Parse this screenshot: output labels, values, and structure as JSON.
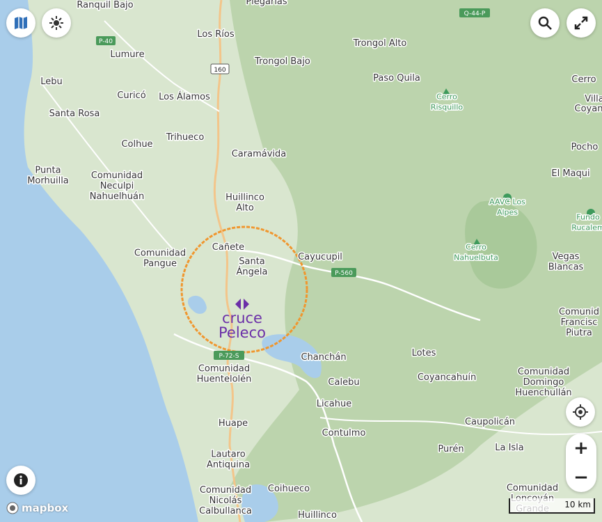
{
  "map": {
    "places": [
      {
        "id": "ranquil-bajo",
        "label": "Ranquil Bajo"
      },
      {
        "id": "pleglarias",
        "label": "Plegarias"
      },
      {
        "id": "los-rios",
        "label": "Los Ríos"
      },
      {
        "id": "trongol-alto",
        "label": "Trongol Alto"
      },
      {
        "id": "lumure",
        "label": "Lumure"
      },
      {
        "id": "trongol-bajo",
        "label": "Trongol Bajo"
      },
      {
        "id": "lebu",
        "label": "Lebu"
      },
      {
        "id": "paso-quila",
        "label": "Paso Quila"
      },
      {
        "id": "cerro",
        "label": "Cerro"
      },
      {
        "id": "curico",
        "label": "Curicó"
      },
      {
        "id": "los-alamos",
        "label": "Los Álamos"
      },
      {
        "id": "villa",
        "label": "Villa"
      },
      {
        "id": "santa-rosa",
        "label": "Santa Rosa"
      },
      {
        "id": "coyanco",
        "label": "Coyan"
      },
      {
        "id": "trihueco",
        "label": "Trihueco"
      },
      {
        "id": "colhue",
        "label": "Colhue"
      },
      {
        "id": "pocho",
        "label": "Pocho"
      },
      {
        "id": "caramavida",
        "label": "Caramávida"
      },
      {
        "id": "el-maqui",
        "label": "El Maqui"
      },
      {
        "id": "punta-morhuilla",
        "label": "Punta\nMorhuilla"
      },
      {
        "id": "comunidad-neculpi",
        "label": "Comunidad\nNeculpi\nNahuelhuán"
      },
      {
        "id": "huillinco-alto",
        "label": "Huillinco\nAlto"
      },
      {
        "id": "canete",
        "label": "Cañete"
      },
      {
        "id": "comunidad-pangue",
        "label": "Comunidad\nPangue"
      },
      {
        "id": "santa-angela",
        "label": "Santa\nÁngela"
      },
      {
        "id": "cayucupil",
        "label": "Cayucupil"
      },
      {
        "id": "vegas-blancas",
        "label": "Vegas\nBlancas"
      },
      {
        "id": "chanchan",
        "label": "Chanchán"
      },
      {
        "id": "lotes",
        "label": "Lotes"
      },
      {
        "id": "comunidad-francisco",
        "label": "Comunid\nFrancisc\nPiutra"
      },
      {
        "id": "comunidad-huentelolen",
        "label": "Comunidad\nHuentelolén"
      },
      {
        "id": "calebu",
        "label": "Calebu"
      },
      {
        "id": "coyancahuin",
        "label": "Coyancahuín"
      },
      {
        "id": "comunidad-domingo",
        "label": "Comunidad\nDomingo\nHuenchullán"
      },
      {
        "id": "licahue",
        "label": "Licahue"
      },
      {
        "id": "huape",
        "label": "Huape"
      },
      {
        "id": "caupolican",
        "label": "Caupolicán"
      },
      {
        "id": "contulmo",
        "label": "Contulmo"
      },
      {
        "id": "puren",
        "label": "Purén"
      },
      {
        "id": "la-isla",
        "label": "La Isla"
      },
      {
        "id": "lautaro-antiquina",
        "label": "Lautaro\nAntiquina"
      },
      {
        "id": "coihueco",
        "label": "Coihueco"
      },
      {
        "id": "comunidad-nicolas",
        "label": "Comunidad\nNicolás\nCalbullanca"
      },
      {
        "id": "huillinco",
        "label": "Huillinco"
      },
      {
        "id": "comunidad-oncoyan",
        "label": "Comunidad\nLoncoyán\nGrande"
      }
    ],
    "peaks": [
      {
        "id": "cerro-risquillo",
        "label": "Cerro\nRisquillo"
      },
      {
        "id": "aavc-los-alpes",
        "label": "AAVC Los\nAlpes"
      },
      {
        "id": "cerro-nahuelbuta",
        "label": "Cerro\nNahuelbuta"
      },
      {
        "id": "fundo-rucalem",
        "label": "Fundo\nRucalem"
      }
    ],
    "road_shields": [
      {
        "id": "p-40",
        "label": "P-40"
      },
      {
        "id": "q-44-p",
        "label": "Q-44-P"
      },
      {
        "id": "r160",
        "label": "160"
      },
      {
        "id": "p-560",
        "label": "P-560"
      },
      {
        "id": "p-72-s",
        "label": "P-72-S"
      }
    ],
    "marker": {
      "line1": "cruce",
      "line2": "Peleco",
      "color": "#6b2fa8",
      "ring_color": "#f0962e"
    },
    "colors": {
      "land": "#d9e6cf",
      "forest": "#bcd4ad",
      "water": "#a9cdea",
      "road": "#ffffff",
      "major_road": "#f3c58a",
      "shield": "#4a9a5a"
    }
  },
  "controls": {
    "layers_icon": "map-icon",
    "style_icon": "sun-icon",
    "search_icon": "search-icon",
    "fullscreen_icon": "expand-icon",
    "info_icon": "info-icon",
    "locate_icon": "locate-icon",
    "zoom_in": "+",
    "zoom_out": "−"
  },
  "attribution": {
    "brand": "mapbox"
  },
  "scale": {
    "label": "10 km"
  }
}
